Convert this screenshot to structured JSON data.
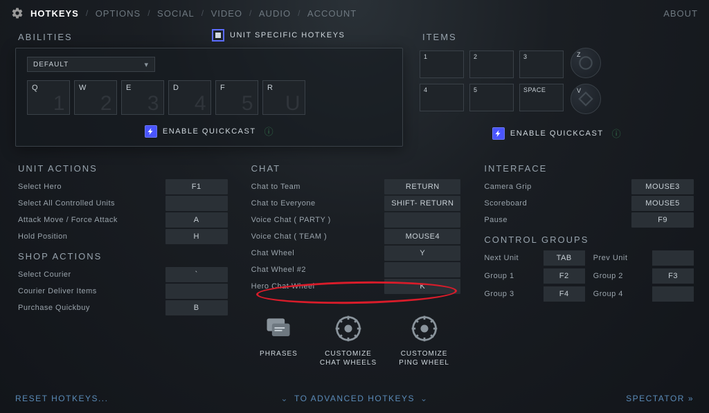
{
  "nav": {
    "hotkeys": "HOTKEYS",
    "options": "OPTIONS",
    "social": "SOCIAL",
    "video": "VIDEO",
    "audio": "AUDIO",
    "account": "ACCOUNT",
    "about": "ABOUT"
  },
  "abilities": {
    "title": "ABILITIES",
    "preset": "DEFAULT",
    "keys": [
      {
        "bind": "Q",
        "ghost": "1"
      },
      {
        "bind": "W",
        "ghost": "2"
      },
      {
        "bind": "E",
        "ghost": "3"
      },
      {
        "bind": "D",
        "ghost": "4"
      },
      {
        "bind": "F",
        "ghost": "5"
      },
      {
        "bind": "R",
        "ghost": "U"
      }
    ],
    "quickcast": "ENABLE QUICKCAST",
    "unit_specific": "UNIT SPECIFIC HOTKEYS"
  },
  "items": {
    "title": "ITEMS",
    "slots": [
      {
        "bind": "1"
      },
      {
        "bind": "2"
      },
      {
        "bind": "3"
      },
      {
        "bind": "4"
      },
      {
        "bind": "5"
      },
      {
        "bind": "SPACE"
      }
    ],
    "round": [
      {
        "bind": "Z"
      },
      {
        "bind": "V"
      }
    ],
    "quickcast": "ENABLE QUICKCAST"
  },
  "unit_actions": {
    "title": "UNIT ACTIONS",
    "rows": [
      {
        "label": "Select Hero",
        "key": "F1"
      },
      {
        "label": "Select All Controlled Units",
        "key": ""
      },
      {
        "label": "Attack Move / Force Attack",
        "key": "A"
      },
      {
        "label": "Hold Position",
        "key": "H"
      }
    ]
  },
  "shop_actions": {
    "title": "SHOP ACTIONS",
    "rows": [
      {
        "label": "Select Courier",
        "key": "`"
      },
      {
        "label": "Courier Deliver Items",
        "key": ""
      },
      {
        "label": "Purchase Quickbuy",
        "key": "B"
      }
    ]
  },
  "chat": {
    "title": "CHAT",
    "rows": [
      {
        "label": "Chat to Team",
        "key": "RETURN"
      },
      {
        "label": "Chat to Everyone",
        "key": "SHIFT- RETURN"
      },
      {
        "label": "Voice Chat ( PARTY )",
        "key": ""
      },
      {
        "label": "Voice Chat ( TEAM )",
        "key": "MOUSE4"
      },
      {
        "label": "Chat Wheel",
        "key": "Y"
      },
      {
        "label": "Chat Wheel #2",
        "key": ""
      },
      {
        "label": "Hero Chat Wheel",
        "key": "K"
      }
    ],
    "icons": {
      "phrases": "PHRASES",
      "chatwheels": "CUSTOMIZE\nCHAT WHEELS",
      "pingwheel": "CUSTOMIZE\nPING WHEEL"
    }
  },
  "interface": {
    "title": "INTERFACE",
    "rows": [
      {
        "label": "Camera Grip",
        "key": "MOUSE3"
      },
      {
        "label": "Scoreboard",
        "key": "MOUSE5"
      },
      {
        "label": "Pause",
        "key": "F9"
      }
    ]
  },
  "control_groups": {
    "title": "CONTROL GROUPS",
    "rows": [
      {
        "l1": "Next Unit",
        "k1": "TAB",
        "l2": "Prev Unit",
        "k2": ""
      },
      {
        "l1": "Group 1",
        "k1": "F2",
        "l2": "Group 2",
        "k2": "F3"
      },
      {
        "l1": "Group 3",
        "k1": "F4",
        "l2": "Group 4",
        "k2": ""
      }
    ]
  },
  "bottom": {
    "reset": "RESET HOTKEYS...",
    "advanced": "TO ADVANCED HOTKEYS",
    "spectator": "SPECTATOR"
  }
}
